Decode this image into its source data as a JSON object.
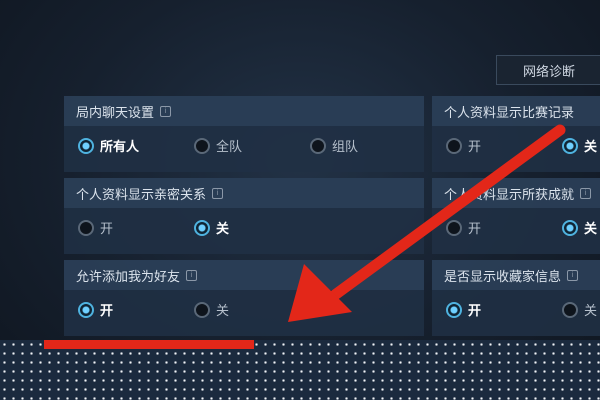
{
  "header": {
    "network_diag_label": "网络诊断"
  },
  "settings": [
    {
      "title": "局内聊天设置",
      "options": [
        {
          "label": "所有人",
          "selected": true
        },
        {
          "label": "全队",
          "selected": false
        },
        {
          "label": "组队",
          "selected": false
        }
      ]
    },
    {
      "title": "个人资料显示亲密关系",
      "options": [
        {
          "label": "开",
          "selected": false
        },
        {
          "label": "关",
          "selected": true
        }
      ]
    },
    {
      "title": "允许添加我为好友",
      "options": [
        {
          "label": "开",
          "selected": true
        },
        {
          "label": "关",
          "selected": false
        }
      ]
    },
    {
      "title": "个人资料显示比赛记录",
      "options": [
        {
          "label": "开",
          "selected": false
        },
        {
          "label": "关",
          "selected": true
        }
      ]
    },
    {
      "title": "个人资料显示所获成就",
      "options": [
        {
          "label": "开",
          "selected": false
        },
        {
          "label": "关",
          "selected": true
        }
      ]
    },
    {
      "title": "是否显示收藏家信息",
      "options": [
        {
          "label": "开",
          "selected": true
        },
        {
          "label": "关",
          "selected": false
        }
      ]
    }
  ],
  "info_icon_glyph": "i",
  "colors": {
    "annotation_red": "#e32719",
    "radio_selected": "#4fb3e0"
  }
}
